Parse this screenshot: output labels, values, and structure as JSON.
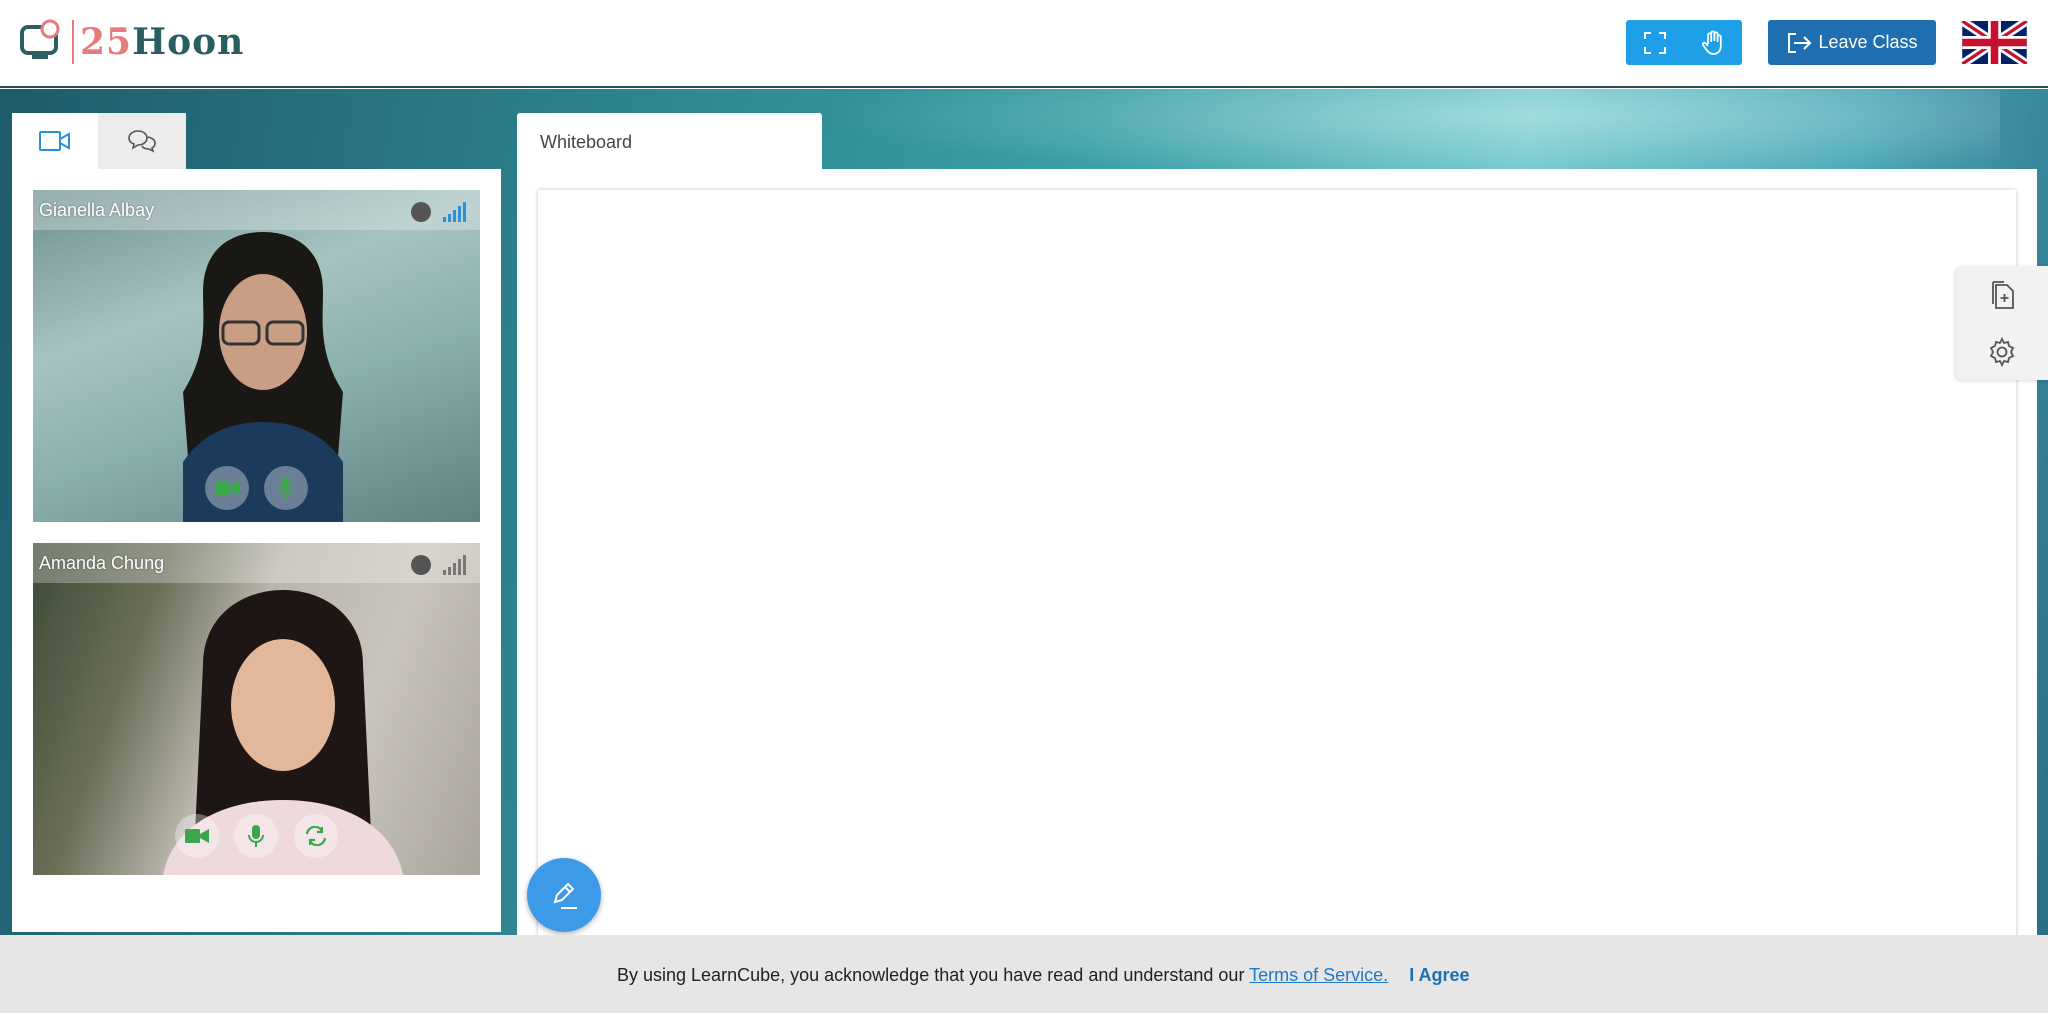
{
  "header": {
    "logo_text_number": "25",
    "logo_text_word": "Hoon",
    "leave_label": "Leave Class"
  },
  "left_panel": {
    "tabs": [
      {
        "icon": "video-camera-icon",
        "active": true
      },
      {
        "icon": "chat-bubbles-icon",
        "active": false
      }
    ],
    "participants": [
      {
        "name": "Gianella Albay",
        "signal_color": "#2a90d8"
      },
      {
        "name": "Amanda Chung",
        "signal_color": "#777777"
      }
    ]
  },
  "whiteboard": {
    "tab_label": "Whiteboard"
  },
  "terms_bar": {
    "text": "By using LearnCube, you acknowledge that you have read and understand our",
    "link_text": "Terms of Service.",
    "agree_label": "I Agree"
  },
  "colors": {
    "accent": "#1ea0e8",
    "leave": "#1f6fb0",
    "control_green": "#3aa84a"
  }
}
